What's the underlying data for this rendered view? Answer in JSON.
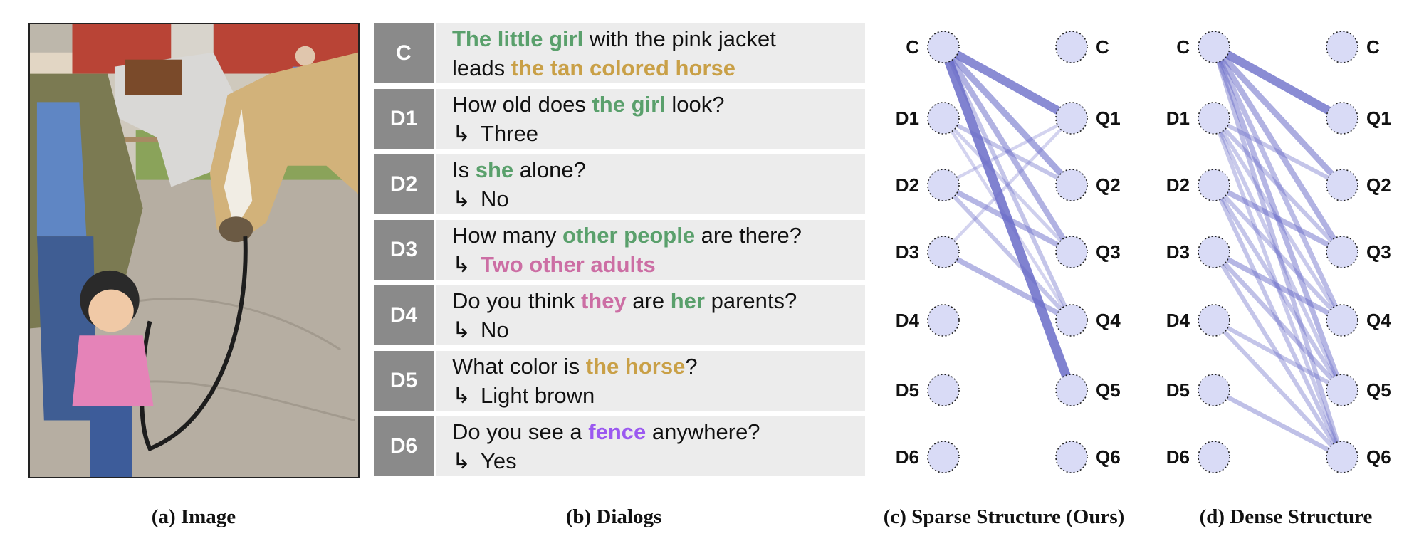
{
  "colors": {
    "girl": "#5aa06c",
    "horse": "#c9a047",
    "adults": "#cc6ea4",
    "fence": "#9b59f0",
    "tag_bg": "#8a8a8a",
    "row_bg": "#ececec",
    "node_fill": "#d9dbf6",
    "edge": "#6a6cc8"
  },
  "dialogs": [
    {
      "tag": "C",
      "lines": [
        [
          {
            "t": "The little girl",
            "c": "girl"
          },
          {
            "t": " with the pink jacket"
          }
        ],
        [
          {
            "t": "leads "
          },
          {
            "t": "the tan colored horse",
            "c": "horse"
          }
        ]
      ]
    },
    {
      "tag": "D1",
      "lines": [
        [
          {
            "t": "How old does "
          },
          {
            "t": "the girl",
            "c": "girl"
          },
          {
            "t": " look?"
          }
        ],
        [
          {
            "t": "↳",
            "a": true
          },
          {
            "t": "Three"
          }
        ]
      ]
    },
    {
      "tag": "D2",
      "lines": [
        [
          {
            "t": "Is "
          },
          {
            "t": "she",
            "c": "girl"
          },
          {
            "t": " alone?"
          }
        ],
        [
          {
            "t": "↳",
            "a": true
          },
          {
            "t": "No"
          }
        ]
      ]
    },
    {
      "tag": "D3",
      "lines": [
        [
          {
            "t": "How many "
          },
          {
            "t": "other people",
            "c": "girl"
          },
          {
            "t": " are there?"
          }
        ],
        [
          {
            "t": "↳",
            "a": true
          },
          {
            "t": "Two other adults",
            "c": "adults"
          }
        ]
      ]
    },
    {
      "tag": "D4",
      "lines": [
        [
          {
            "t": "Do you think "
          },
          {
            "t": "they",
            "c": "adults"
          },
          {
            "t": " are "
          },
          {
            "t": "her",
            "c": "girl"
          },
          {
            "t": " parents?"
          }
        ],
        [
          {
            "t": "↳",
            "a": true
          },
          {
            "t": "No"
          }
        ]
      ]
    },
    {
      "tag": "D5",
      "lines": [
        [
          {
            "t": "What color is "
          },
          {
            "t": "the horse",
            "c": "horse"
          },
          {
            "t": "?"
          }
        ],
        [
          {
            "t": "↳",
            "a": true
          },
          {
            "t": "Light brown"
          }
        ]
      ]
    },
    {
      "tag": "D6",
      "lines": [
        [
          {
            "t": "Do you see a "
          },
          {
            "t": "fence",
            "c": "fence"
          },
          {
            "t": " anywhere?"
          }
        ],
        [
          {
            "t": "↳",
            "a": true
          },
          {
            "t": "Yes"
          }
        ]
      ]
    }
  ],
  "graph_nodes": {
    "left": [
      "C",
      "D1",
      "D2",
      "D3",
      "D4",
      "D5",
      "D6"
    ],
    "right": [
      "C",
      "Q1",
      "Q2",
      "Q3",
      "Q4",
      "Q5",
      "Q6"
    ]
  },
  "sparse_edges": [
    {
      "from": "C",
      "to": "Q1",
      "w": 0.9
    },
    {
      "from": "C",
      "to": "Q5",
      "w": 1.0
    },
    {
      "from": "C",
      "to": "Q2",
      "w": 0.6
    },
    {
      "from": "C",
      "to": "Q3",
      "w": 0.5
    },
    {
      "from": "C",
      "to": "Q4",
      "w": 0.3
    },
    {
      "from": "D1",
      "to": "Q2",
      "w": 0.3
    },
    {
      "from": "D1",
      "to": "Q3",
      "w": 0.2
    },
    {
      "from": "D1",
      "to": "Q4",
      "w": 0.15
    },
    {
      "from": "D2",
      "to": "Q3",
      "w": 0.45
    },
    {
      "from": "D2",
      "to": "Q4",
      "w": 0.3
    },
    {
      "from": "D2",
      "to": "Q1",
      "w": 0.15
    },
    {
      "from": "D3",
      "to": "Q4",
      "w": 0.45
    },
    {
      "from": "D3",
      "to": "Q1",
      "w": 0.15
    }
  ],
  "dense_edges": [
    {
      "from": "C",
      "to": "Q1",
      "w": 0.9
    },
    {
      "from": "C",
      "to": "Q2",
      "w": 0.55
    },
    {
      "from": "C",
      "to": "Q3",
      "w": 0.5
    },
    {
      "from": "C",
      "to": "Q4",
      "w": 0.4
    },
    {
      "from": "C",
      "to": "Q5",
      "w": 0.45
    },
    {
      "from": "C",
      "to": "Q6",
      "w": 0.35
    },
    {
      "from": "D1",
      "to": "Q2",
      "w": 0.3
    },
    {
      "from": "D1",
      "to": "Q3",
      "w": 0.3
    },
    {
      "from": "D1",
      "to": "Q4",
      "w": 0.25
    },
    {
      "from": "D1",
      "to": "Q5",
      "w": 0.25
    },
    {
      "from": "D1",
      "to": "Q6",
      "w": 0.25
    },
    {
      "from": "D2",
      "to": "Q3",
      "w": 0.45
    },
    {
      "from": "D2",
      "to": "Q4",
      "w": 0.3
    },
    {
      "from": "D2",
      "to": "Q5",
      "w": 0.3
    },
    {
      "from": "D2",
      "to": "Q6",
      "w": 0.3
    },
    {
      "from": "D3",
      "to": "Q4",
      "w": 0.45
    },
    {
      "from": "D3",
      "to": "Q5",
      "w": 0.35
    },
    {
      "from": "D3",
      "to": "Q6",
      "w": 0.3
    },
    {
      "from": "D4",
      "to": "Q5",
      "w": 0.3
    },
    {
      "from": "D4",
      "to": "Q6",
      "w": 0.3
    },
    {
      "from": "D5",
      "to": "Q6",
      "w": 0.35
    }
  ],
  "captions": {
    "a": "(a) Image",
    "b": "(b) Dialogs",
    "c": "(c) Sparse Structure (Ours)",
    "d": "(d) Dense Structure"
  }
}
